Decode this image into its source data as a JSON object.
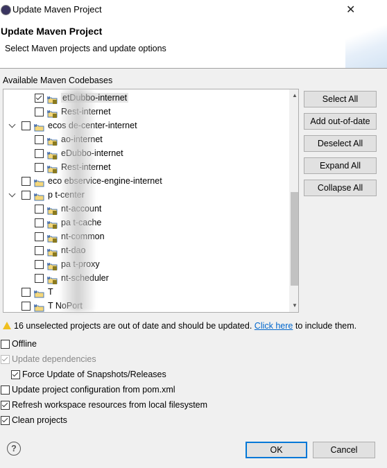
{
  "window": {
    "title": "Update Maven Project"
  },
  "header": {
    "title": "Update Maven Project",
    "subtitle": "Select Maven projects and update options"
  },
  "tree_label": "Available Maven Codebases",
  "tree": [
    {
      "label": "etDubbo-internet",
      "level": 1,
      "checked": true,
      "selected": true
    },
    {
      "label": "Rest-internet",
      "level": 1,
      "checked": false
    },
    {
      "label": "ecos      de-center-internet",
      "level": 0,
      "checked": false,
      "expanded": true
    },
    {
      "label": "ao-internet",
      "level": 1,
      "checked": false
    },
    {
      "label": "eDubbo-internet",
      "level": 1,
      "checked": false
    },
    {
      "label": "Rest-internet",
      "level": 1,
      "checked": false
    },
    {
      "label": "eco      ebservice-engine-internet",
      "level": 0,
      "checked": false
    },
    {
      "label": "p        t-center",
      "level": 0,
      "checked": false,
      "expanded": true
    },
    {
      "label": "nt-account",
      "level": 1,
      "checked": false
    },
    {
      "label": "pa      t-cache",
      "level": 1,
      "checked": false
    },
    {
      "label": "nt-common",
      "level": 1,
      "checked": false
    },
    {
      "label": "nt-dao",
      "level": 1,
      "checked": false
    },
    {
      "label": "pa      t-proxy",
      "level": 1,
      "checked": false
    },
    {
      "label": "nt-scheduler",
      "level": 1,
      "checked": false
    },
    {
      "label": "T",
      "level": 0,
      "checked": false
    },
    {
      "label": "T         NoPort",
      "level": 0,
      "checked": false
    }
  ],
  "side_buttons": [
    "Select All",
    "Add out-of-date",
    "Deselect All",
    "Expand All",
    "Collapse All"
  ],
  "warning": {
    "text": "16 unselected projects are out of date and should be updated.",
    "link": "Click here",
    "suffix": "to include them."
  },
  "options": [
    {
      "label": "Offline",
      "checked": false,
      "enabled": true,
      "indent": 0
    },
    {
      "label": "Update dependencies",
      "checked": true,
      "enabled": false,
      "indent": 0
    },
    {
      "label": "Force Update of Snapshots/Releases",
      "checked": true,
      "enabled": true,
      "indent": 1
    },
    {
      "label": "Update project configuration from pom.xml",
      "checked": false,
      "enabled": true,
      "indent": 0
    },
    {
      "label": "Refresh workspace resources from local filesystem",
      "checked": true,
      "enabled": true,
      "indent": 0
    },
    {
      "label": "Clean projects",
      "checked": true,
      "enabled": true,
      "indent": 0
    }
  ],
  "footer": {
    "help": "?",
    "ok": "OK",
    "cancel": "Cancel",
    "close": "✕"
  }
}
